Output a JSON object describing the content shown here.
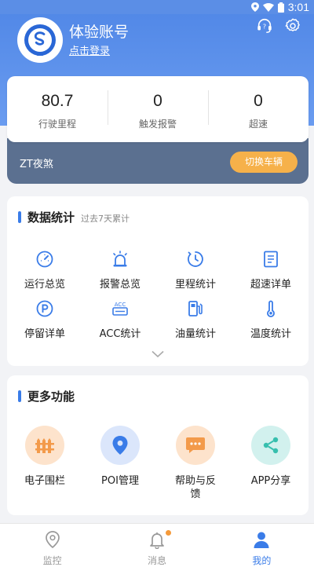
{
  "status_bar": {
    "time": "3:01"
  },
  "profile": {
    "username": "体验账号",
    "login_link": "点击登录"
  },
  "stats": [
    {
      "value": "80.7",
      "label": "行驶里程"
    },
    {
      "value": "0",
      "label": "触发报警"
    },
    {
      "value": "0",
      "label": "超速"
    }
  ],
  "vehicle": {
    "name": "ZT夜煞",
    "switch_label": "切换车辆"
  },
  "data_stats": {
    "title": "数据统计",
    "subtitle": "过去7天累计",
    "items": [
      {
        "label": "运行总览",
        "icon": "speedometer-icon"
      },
      {
        "label": "报警总览",
        "icon": "alarm-light-icon"
      },
      {
        "label": "里程统计",
        "icon": "clock-icon"
      },
      {
        "label": "超速详单",
        "icon": "report-icon"
      },
      {
        "label": "停留详单",
        "icon": "parking-icon"
      },
      {
        "label": "ACC统计",
        "icon": "acc-icon"
      },
      {
        "label": "油量统计",
        "icon": "fuel-pump-icon"
      },
      {
        "label": "温度统计",
        "icon": "thermometer-icon"
      }
    ]
  },
  "more": {
    "title": "更多功能",
    "items": [
      {
        "label": "电子围栏",
        "icon": "fence-icon",
        "color": "#fde3cc",
        "icon_color": "#f39a4a"
      },
      {
        "label": "POI管理",
        "icon": "location-pin-icon",
        "color": "#dbe6fb",
        "icon_color": "#3a7ce8"
      },
      {
        "label": "帮助与反馈",
        "icon": "chat-bubble-icon",
        "color": "#fde3cc",
        "icon_color": "#f39a4a"
      },
      {
        "label": "APP分享",
        "icon": "share-icon",
        "color": "#d2f1ee",
        "icon_color": "#37bfae"
      }
    ]
  },
  "tabs": [
    {
      "label": "监控",
      "icon": "location-outline-icon",
      "active": false
    },
    {
      "label": "消息",
      "icon": "bell-icon",
      "active": false
    },
    {
      "label": "我的",
      "icon": "person-icon",
      "active": true
    }
  ],
  "colors": {
    "primary": "#3a7ce8",
    "header": "#5b8ee6",
    "accent": "#f6b14a",
    "vehicle_bar": "#5b7090"
  }
}
